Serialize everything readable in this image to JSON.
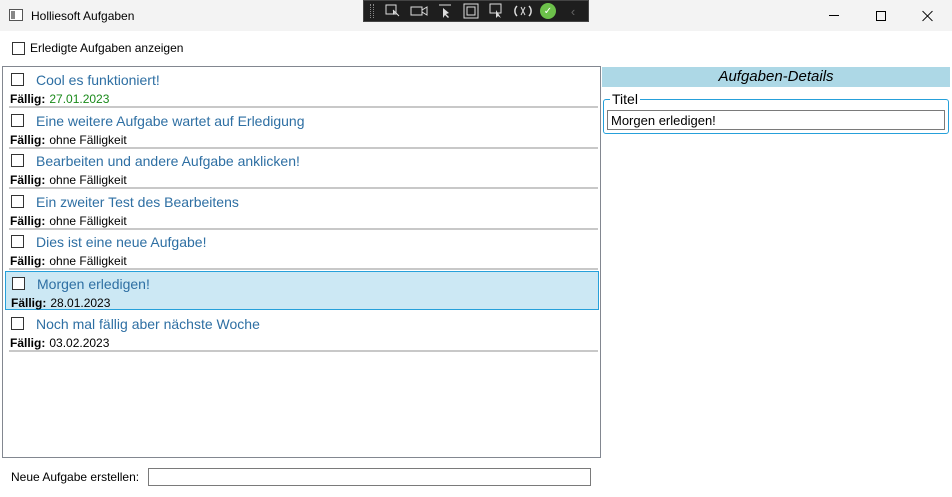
{
  "window": {
    "title": "Holliesoft Aufgaben",
    "controls": {
      "minimize_icon": "minimize-icon",
      "maximize_icon": "maximize-icon",
      "close_icon": "close-icon"
    }
  },
  "devtools_toolbar": {
    "icons": [
      "select-element-icon",
      "video-icon",
      "pointer-icon",
      "frame-icon",
      "adorner-icon",
      "hot-reload-icon",
      "check-icon",
      "chevron-left-icon"
    ],
    "check_color": "#6cc04a"
  },
  "filter": {
    "show_completed_label": "Erledigte Aufgaben anzeigen",
    "checked": false
  },
  "tasks": {
    "due_label": "Fällig:",
    "items": [
      {
        "title": "Cool es funktioniert!",
        "due": "27.01.2023",
        "checked": false,
        "due_color": "#1a8a1a"
      },
      {
        "title": "Eine weitere Aufgabe wartet auf Erledigung",
        "due": "ohne Fälligkeit",
        "checked": false
      },
      {
        "title": "Bearbeiten und andere Aufgabe anklicken!",
        "due": "ohne Fälligkeit",
        "checked": false
      },
      {
        "title": "Ein zweiter Test des Bearbeitens",
        "due": "ohne Fälligkeit",
        "checked": false
      },
      {
        "title": "Dies ist eine neue Aufgabe!",
        "due": "ohne Fälligkeit",
        "checked": false
      },
      {
        "title": "Morgen erledigen!",
        "due": "28.01.2023",
        "checked": false,
        "selected": true
      },
      {
        "title": "Noch mal fällig aber nächste Woche",
        "due": "03.02.2023",
        "checked": false
      }
    ],
    "title_color": "#2e6fa3",
    "selected_bg": "#cce8f4"
  },
  "details": {
    "header": "Aufgaben-Details",
    "header_bg": "#add8e6",
    "title_group_label": "Titel",
    "title_value": "Morgen erledigen!"
  },
  "new_task": {
    "label": "Neue Aufgabe erstellen:",
    "value": ""
  }
}
